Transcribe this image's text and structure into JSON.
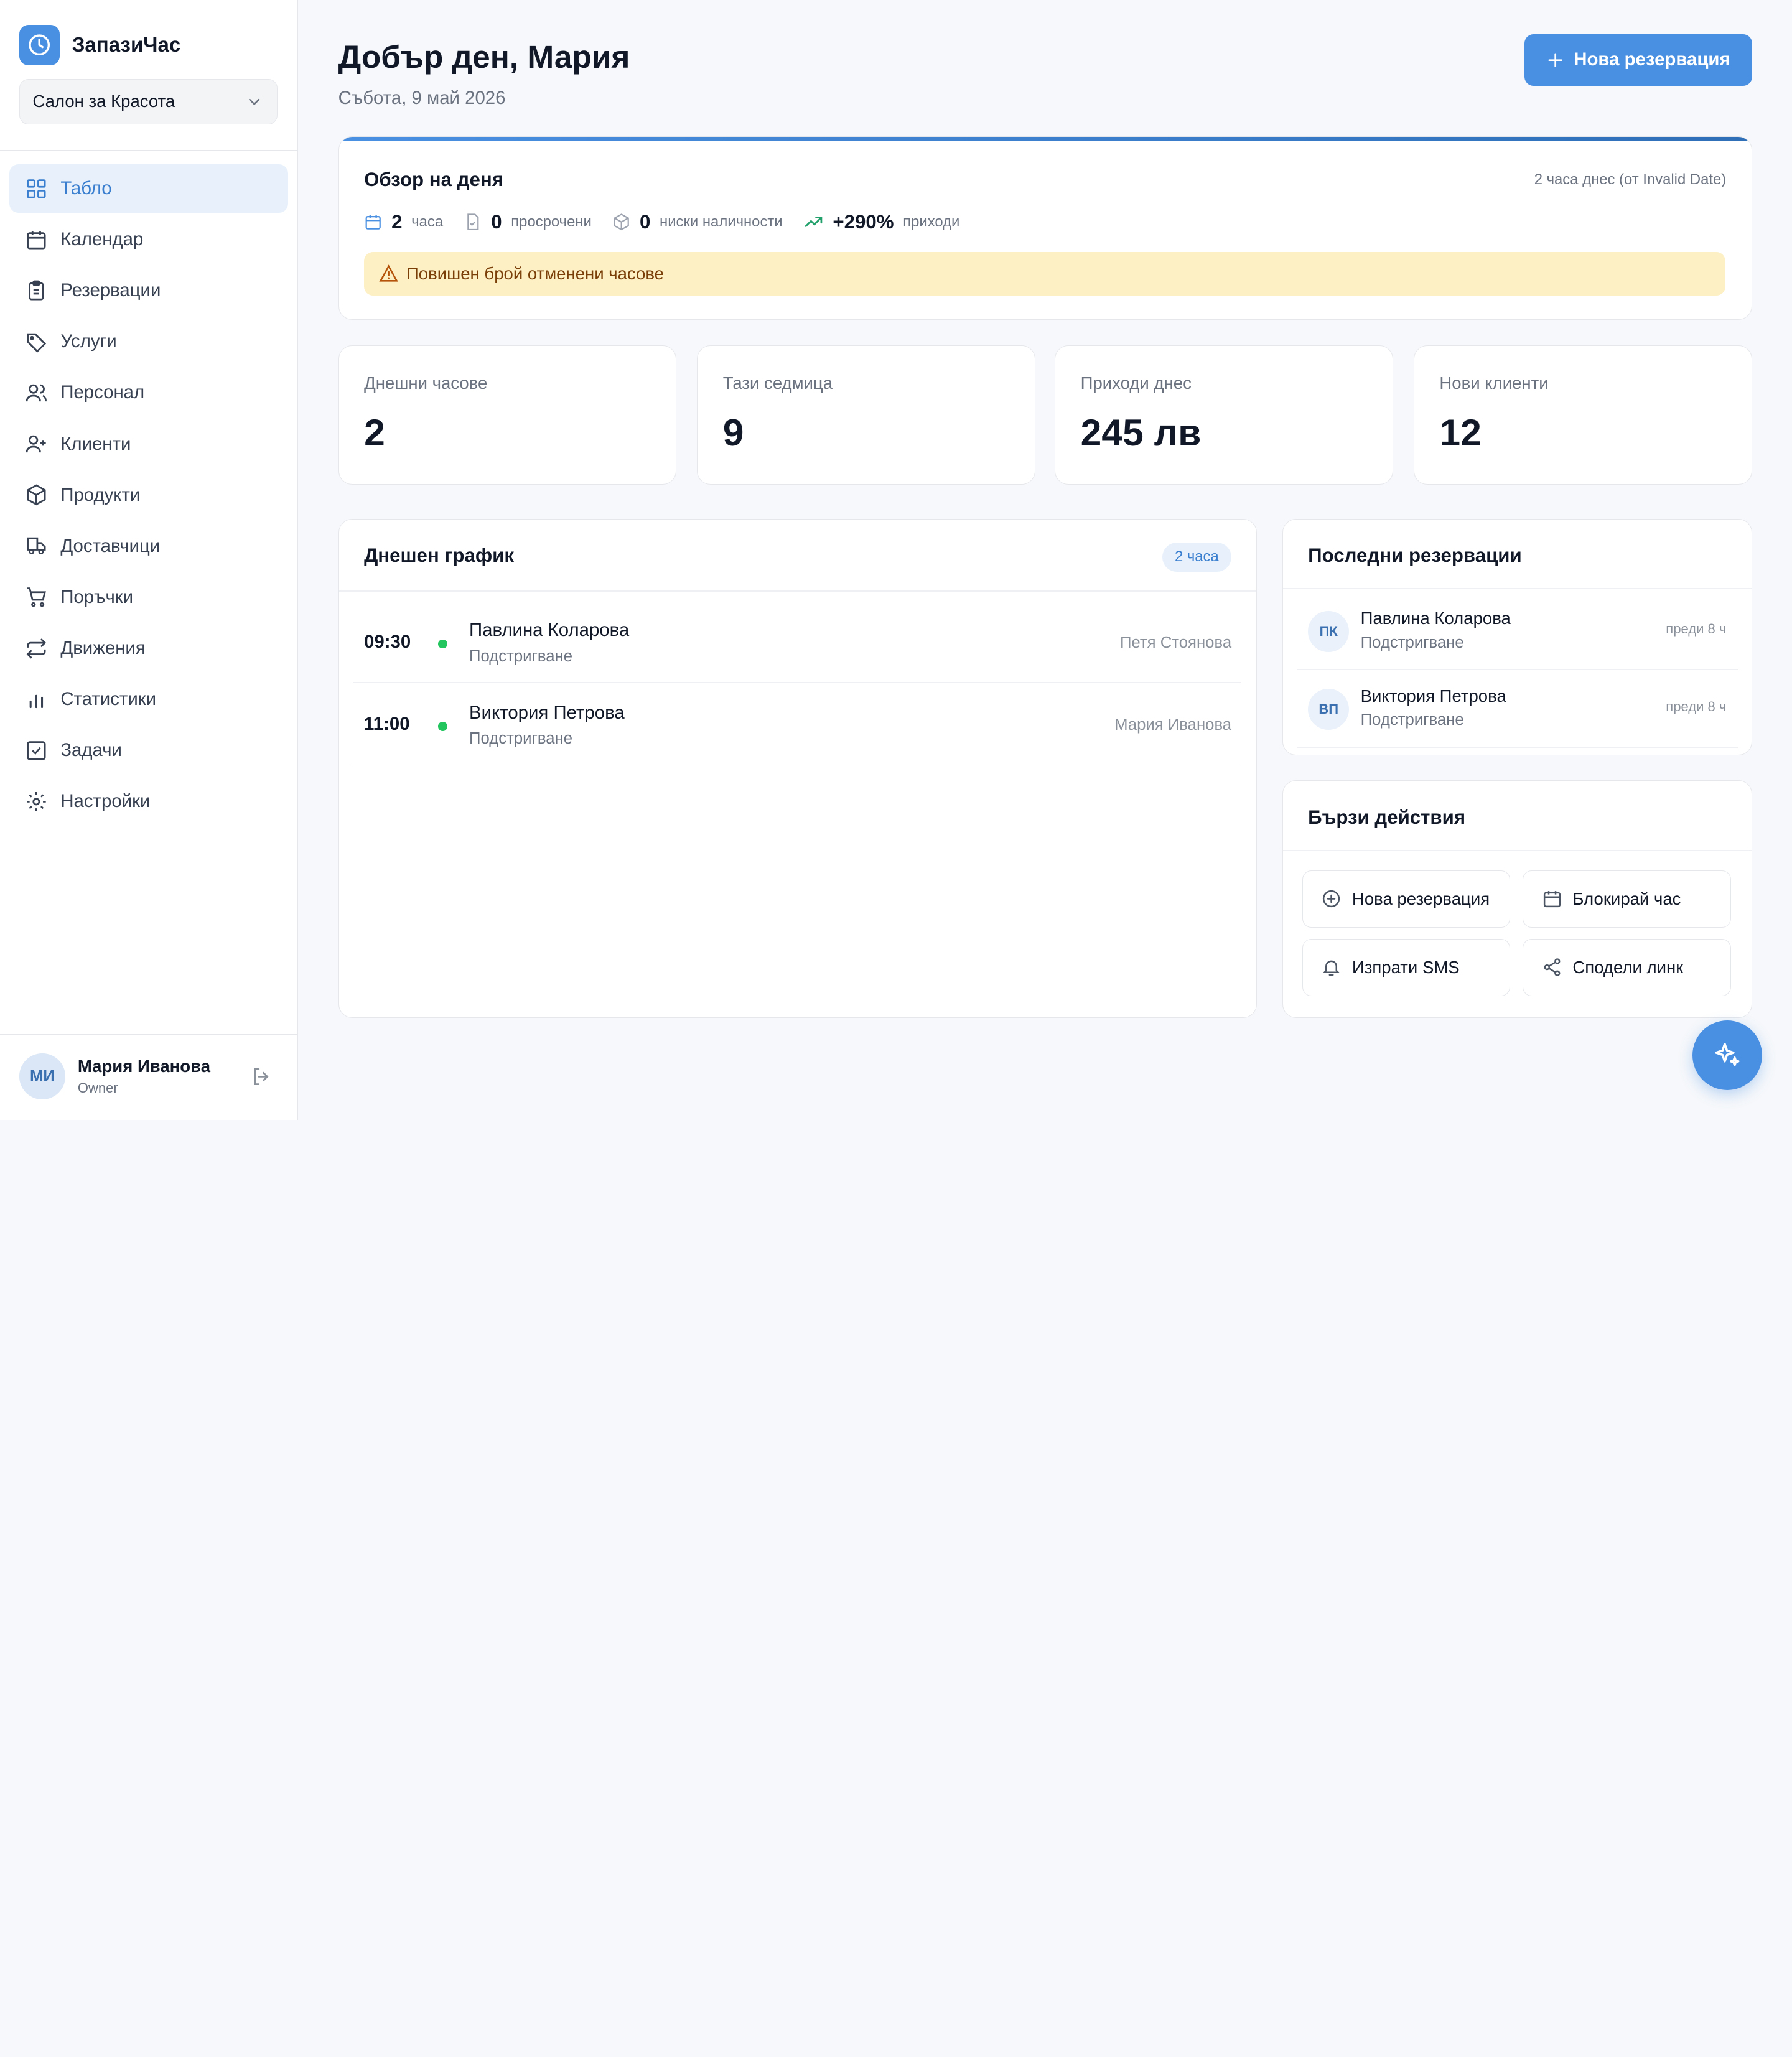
{
  "app": {
    "name": "ЗапазиЧас",
    "salon": "Салон за Красота"
  },
  "nav": [
    {
      "label": "Табло",
      "icon": "dashboard-icon",
      "active": true
    },
    {
      "label": "Календар",
      "icon": "calendar-icon"
    },
    {
      "label": "Резервации",
      "icon": "clipboard-icon"
    },
    {
      "label": "Услуги",
      "icon": "tag-icon"
    },
    {
      "label": "Персонал",
      "icon": "users-icon"
    },
    {
      "label": "Клиенти",
      "icon": "user-plus-icon"
    },
    {
      "label": "Продукти",
      "icon": "box-icon"
    },
    {
      "label": "Доставчици",
      "icon": "truck-icon"
    },
    {
      "label": "Поръчки",
      "icon": "cart-icon"
    },
    {
      "label": "Движения",
      "icon": "repeat-icon"
    },
    {
      "label": "Статистики",
      "icon": "bar-chart-icon"
    },
    {
      "label": "Задачи",
      "icon": "check-square-icon"
    },
    {
      "label": "Настройки",
      "icon": "gear-icon"
    }
  ],
  "user": {
    "initials": "МИ",
    "name": "Мария Иванова",
    "role": "Owner"
  },
  "header": {
    "greeting": "Добър ден, Мария",
    "date": "Събота, 9 май 2026",
    "new_button": "Нова резервация"
  },
  "overview": {
    "title": "Обзор на деня",
    "meta": "2 часа днес (от Invalid Date)",
    "stats": [
      {
        "value": "2",
        "label": "часа"
      },
      {
        "value": "0",
        "label": "просрочени"
      },
      {
        "value": "0",
        "label": "ниски наличности"
      },
      {
        "value": "+290%",
        "label": "приходи"
      }
    ],
    "alert": "Повишен брой отменени часове"
  },
  "stats": [
    {
      "label": "Днешни часове",
      "value": "2"
    },
    {
      "label": "Тази седмица",
      "value": "9"
    },
    {
      "label": "Приходи днес",
      "value": "245 лв"
    },
    {
      "label": "Нови клиенти",
      "value": "12"
    }
  ],
  "schedule": {
    "title": "Днешен график",
    "badge": "2 часа",
    "rows": [
      {
        "time": "09:30",
        "client": "Павлина Коларова",
        "service": "Подстригване",
        "staff": "Петя Стоянова"
      },
      {
        "time": "11:00",
        "client": "Виктория Петрова",
        "service": "Подстригване",
        "staff": "Мария Иванова"
      }
    ]
  },
  "recent": {
    "title": "Последни резервации",
    "rows": [
      {
        "initials": "ПК",
        "client": "Павлина Коларова",
        "service": "Подстригване",
        "ago": "преди 8 ч"
      },
      {
        "initials": "ВП",
        "client": "Виктория Петрова",
        "service": "Подстригване",
        "ago": "преди 8 ч"
      }
    ]
  },
  "quick": {
    "title": "Бързи действия",
    "actions": [
      {
        "label": "Нова резервация",
        "icon": "plus-circle-icon"
      },
      {
        "label": "Блокирай час",
        "icon": "calendar-icon"
      },
      {
        "label": "Изпрати SMS",
        "icon": "bell-icon"
      },
      {
        "label": "Сподели линк",
        "icon": "share-icon"
      }
    ]
  },
  "colors": {
    "accent": "#4a90e2",
    "success": "#22c55e",
    "warning_bg": "#fdf0c4"
  }
}
